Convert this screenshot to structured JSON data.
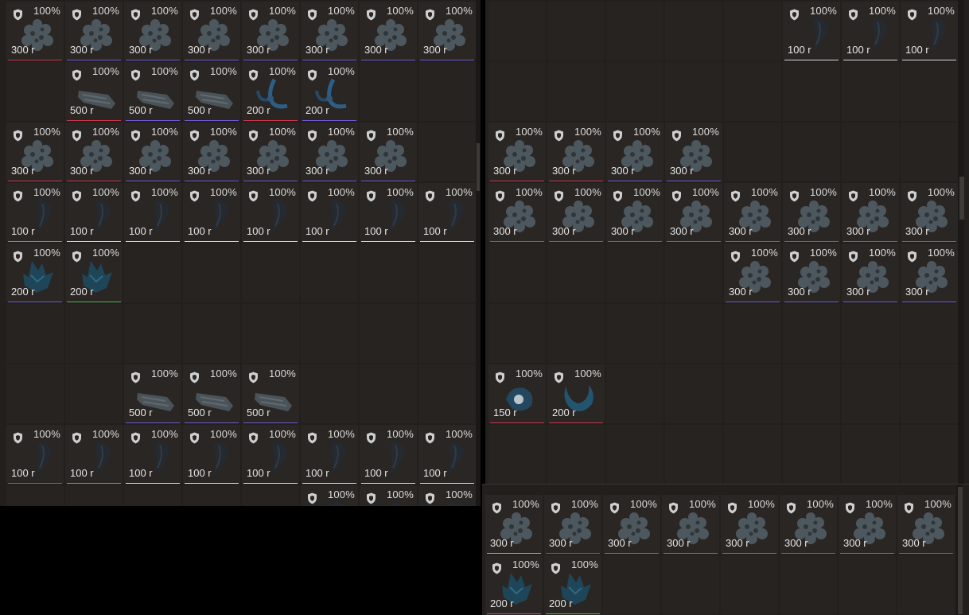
{
  "colors": {
    "red": "#c9374b",
    "purple": "#6e5bd0",
    "green": "#4cb54c",
    "white": "#d8d8d8",
    "pink": "#b24ea0",
    "yellow": "#bfae3a"
  },
  "left_grid": [
    [
      {
        "item": "coral",
        "cond": "100%",
        "price": "300 r",
        "rarity": "red"
      },
      {
        "item": "coral",
        "cond": "100%",
        "price": "300 r",
        "rarity": "purple"
      },
      {
        "item": "coral",
        "cond": "100%",
        "price": "300 r",
        "rarity": "purple"
      },
      {
        "item": "coral",
        "cond": "100%",
        "price": "300 r",
        "rarity": "purple"
      },
      {
        "item": "coral",
        "cond": "100%",
        "price": "300 r",
        "rarity": "purple"
      },
      {
        "item": "coral",
        "cond": "100%",
        "price": "300 r",
        "rarity": "purple"
      },
      {
        "item": "coral",
        "cond": "100%",
        "price": "300 r",
        "rarity": "purple"
      },
      {
        "item": "coral",
        "cond": "100%",
        "price": "300 r",
        "rarity": "purple"
      }
    ],
    [
      null,
      {
        "item": "log",
        "cond": "100%",
        "price": "500 r",
        "rarity": "red"
      },
      {
        "item": "log",
        "cond": "100%",
        "price": "500 r",
        "rarity": "purple"
      },
      {
        "item": "log",
        "cond": "100%",
        "price": "500 r",
        "rarity": "purple"
      },
      {
        "item": "hook",
        "cond": "100%",
        "price": "200 r",
        "rarity": "red"
      },
      {
        "item": "hook",
        "cond": "100%",
        "price": "200 r",
        "rarity": "purple"
      },
      null,
      null
    ],
    [
      {
        "item": "coral",
        "cond": "100%",
        "price": "300 r",
        "rarity": "red"
      },
      {
        "item": "coral",
        "cond": "100%",
        "price": "300 r",
        "rarity": "red"
      },
      {
        "item": "coral",
        "cond": "100%",
        "price": "300 r",
        "rarity": "purple"
      },
      {
        "item": "coral",
        "cond": "100%",
        "price": "300 r",
        "rarity": "purple"
      },
      {
        "item": "coral",
        "cond": "100%",
        "price": "300 r",
        "rarity": "purple"
      },
      {
        "item": "coral",
        "cond": "100%",
        "price": "300 r",
        "rarity": "purple"
      },
      {
        "item": "coral",
        "cond": "100%",
        "price": "300 r",
        "rarity": "purple"
      },
      null
    ],
    [
      {
        "item": "claw",
        "cond": "100%",
        "price": "100 r",
        "rarity": "green"
      },
      {
        "item": "claw",
        "cond": "100%",
        "price": "100 r",
        "rarity": "white"
      },
      {
        "item": "claw",
        "cond": "100%",
        "price": "100 r",
        "rarity": "white"
      },
      {
        "item": "claw",
        "cond": "100%",
        "price": "100 r",
        "rarity": "white"
      },
      {
        "item": "claw",
        "cond": "100%",
        "price": "100 r",
        "rarity": "white"
      },
      {
        "item": "claw",
        "cond": "100%",
        "price": "100 r",
        "rarity": "white"
      },
      {
        "item": "claw",
        "cond": "100%",
        "price": "100 r",
        "rarity": "white"
      },
      {
        "item": "claw",
        "cond": "100%",
        "price": "100 r",
        "rarity": "white"
      }
    ],
    [
      {
        "item": "crystal",
        "cond": "100%",
        "price": "200 r",
        "rarity": "purple"
      },
      {
        "item": "crystal",
        "cond": "100%",
        "price": "200 r",
        "rarity": "green"
      },
      null,
      null,
      null,
      null,
      null,
      null
    ],
    [
      null,
      null,
      null,
      null,
      null,
      null,
      null,
      null
    ],
    [
      null,
      null,
      {
        "item": "log",
        "cond": "100%",
        "price": "500 r",
        "rarity": "purple"
      },
      {
        "item": "log",
        "cond": "100%",
        "price": "500 r",
        "rarity": "purple"
      },
      {
        "item": "log",
        "cond": "100%",
        "price": "500 r",
        "rarity": "purple"
      },
      null,
      null,
      null
    ],
    [
      {
        "item": "claw",
        "cond": "100%",
        "price": "100 r",
        "rarity": "purple"
      },
      {
        "item": "claw",
        "cond": "100%",
        "price": "100 r",
        "rarity": "green"
      },
      {
        "item": "claw",
        "cond": "100%",
        "price": "100 r",
        "rarity": "white"
      },
      {
        "item": "claw",
        "cond": "100%",
        "price": "100 r",
        "rarity": "white"
      },
      {
        "item": "claw",
        "cond": "100%",
        "price": "100 r",
        "rarity": "white"
      },
      {
        "item": "claw",
        "cond": "100%",
        "price": "100 r",
        "rarity": "white"
      },
      {
        "item": "claw",
        "cond": "100%",
        "price": "100 r",
        "rarity": "white"
      },
      {
        "item": "claw",
        "cond": "100%",
        "price": "100 r",
        "rarity": "white"
      }
    ],
    [
      null,
      null,
      null,
      null,
      null,
      {
        "item": "claw",
        "cond": "100%",
        "price": "",
        "rarity": "white"
      },
      {
        "item": "claw",
        "cond": "100%",
        "price": "",
        "rarity": "white"
      },
      {
        "item": "claw",
        "cond": "100%",
        "price": "",
        "rarity": "white"
      }
    ]
  ],
  "right_grid": [
    [
      null,
      null,
      null,
      null,
      null,
      {
        "item": "claw",
        "cond": "100%",
        "price": "100 r",
        "rarity": "white"
      },
      {
        "item": "claw",
        "cond": "100%",
        "price": "100 r",
        "rarity": "white"
      },
      {
        "item": "claw",
        "cond": "100%",
        "price": "100 r",
        "rarity": "white"
      }
    ],
    [
      null,
      null,
      null,
      null,
      null,
      null,
      null,
      null
    ],
    [
      {
        "item": "coral",
        "cond": "100%",
        "price": "300 r",
        "rarity": "red"
      },
      {
        "item": "coral",
        "cond": "100%",
        "price": "300 r",
        "rarity": "red"
      },
      {
        "item": "coral",
        "cond": "100%",
        "price": "300 r",
        "rarity": "purple"
      },
      {
        "item": "coral",
        "cond": "100%",
        "price": "300 r",
        "rarity": "purple"
      },
      null,
      null,
      null,
      null
    ],
    [
      {
        "item": "coral",
        "cond": "100%",
        "price": "300 r",
        "rarity": "purple"
      },
      {
        "item": "coral",
        "cond": "100%",
        "price": "300 r",
        "rarity": "purple"
      },
      {
        "item": "coral",
        "cond": "100%",
        "price": "300 r",
        "rarity": "purple"
      },
      {
        "item": "coral",
        "cond": "100%",
        "price": "300 r",
        "rarity": "purple"
      },
      {
        "item": "coral",
        "cond": "100%",
        "price": "300 r",
        "rarity": "purple"
      },
      {
        "item": "coral",
        "cond": "100%",
        "price": "300 r",
        "rarity": "purple"
      },
      {
        "item": "coral",
        "cond": "100%",
        "price": "300 r",
        "rarity": "purple"
      },
      {
        "item": "coral",
        "cond": "100%",
        "price": "300 r",
        "rarity": "purple"
      }
    ],
    [
      null,
      null,
      null,
      null,
      {
        "item": "coral",
        "cond": "100%",
        "price": "300 r",
        "rarity": "purple"
      },
      {
        "item": "coral",
        "cond": "100%",
        "price": "300 r",
        "rarity": "purple"
      },
      {
        "item": "coral",
        "cond": "100%",
        "price": "300 r",
        "rarity": "purple"
      },
      {
        "item": "coral",
        "cond": "100%",
        "price": "300 r",
        "rarity": "purple"
      }
    ],
    [
      null,
      null,
      null,
      null,
      null,
      null,
      null,
      null
    ],
    [
      {
        "item": "pearl",
        "cond": "100%",
        "price": "150 r",
        "rarity": "red"
      },
      {
        "item": "ring",
        "cond": "100%",
        "price": "200 r",
        "rarity": "red"
      },
      null,
      null,
      null,
      null,
      null,
      null
    ],
    [
      null,
      null,
      null,
      null,
      null,
      null,
      null,
      null
    ]
  ],
  "bottom_grid": [
    [
      {
        "item": "coral",
        "cond": "100%",
        "price": "300 r",
        "rarity": "yellow"
      },
      {
        "item": "coral",
        "cond": "100%",
        "price": "300 r",
        "rarity": "red"
      },
      {
        "item": "coral",
        "cond": "100%",
        "price": "300 r",
        "rarity": "pink"
      },
      {
        "item": "coral",
        "cond": "100%",
        "price": "300 r",
        "rarity": "pink"
      },
      {
        "item": "coral",
        "cond": "100%",
        "price": "300 r",
        "rarity": "pink"
      },
      {
        "item": "coral",
        "cond": "100%",
        "price": "300 r",
        "rarity": "purple"
      },
      {
        "item": "coral",
        "cond": "100%",
        "price": "300 r",
        "rarity": "pink"
      },
      {
        "item": "coral",
        "cond": "100%",
        "price": "300 r",
        "rarity": "purple"
      }
    ],
    [
      {
        "item": "crystal",
        "cond": "100%",
        "price": "200 r",
        "rarity": "pink"
      },
      {
        "item": "crystal",
        "cond": "100%",
        "price": "200 r",
        "rarity": "green"
      },
      null,
      null,
      null,
      null,
      null,
      null
    ]
  ]
}
